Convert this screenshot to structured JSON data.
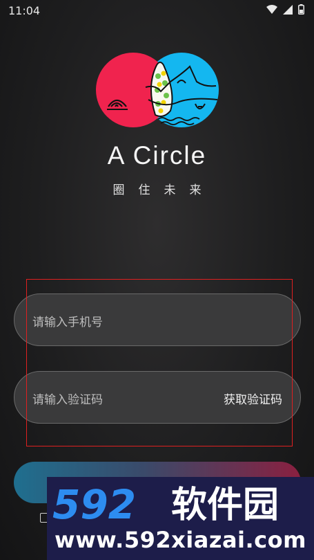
{
  "status_bar": {
    "time": "11:04",
    "icons": [
      "wifi-icon",
      "signal-icon",
      "battery-icon"
    ]
  },
  "app": {
    "title": "A Circle",
    "subtitle": "圈住未来"
  },
  "form": {
    "phone_placeholder": "请输入手机号",
    "code_placeholder": "请输入验证码",
    "get_code_label": "获取验证码"
  },
  "watermark": {
    "brand_number": "592",
    "brand_text": "软件园",
    "url": "www.592xiazai.com"
  },
  "colors": {
    "logo_red": "#f0234e",
    "logo_blue": "#14b7f0",
    "highlight": "#e02020",
    "watermark_bg": "#1d1d4a",
    "watermark_blue": "#2d8cf0"
  }
}
